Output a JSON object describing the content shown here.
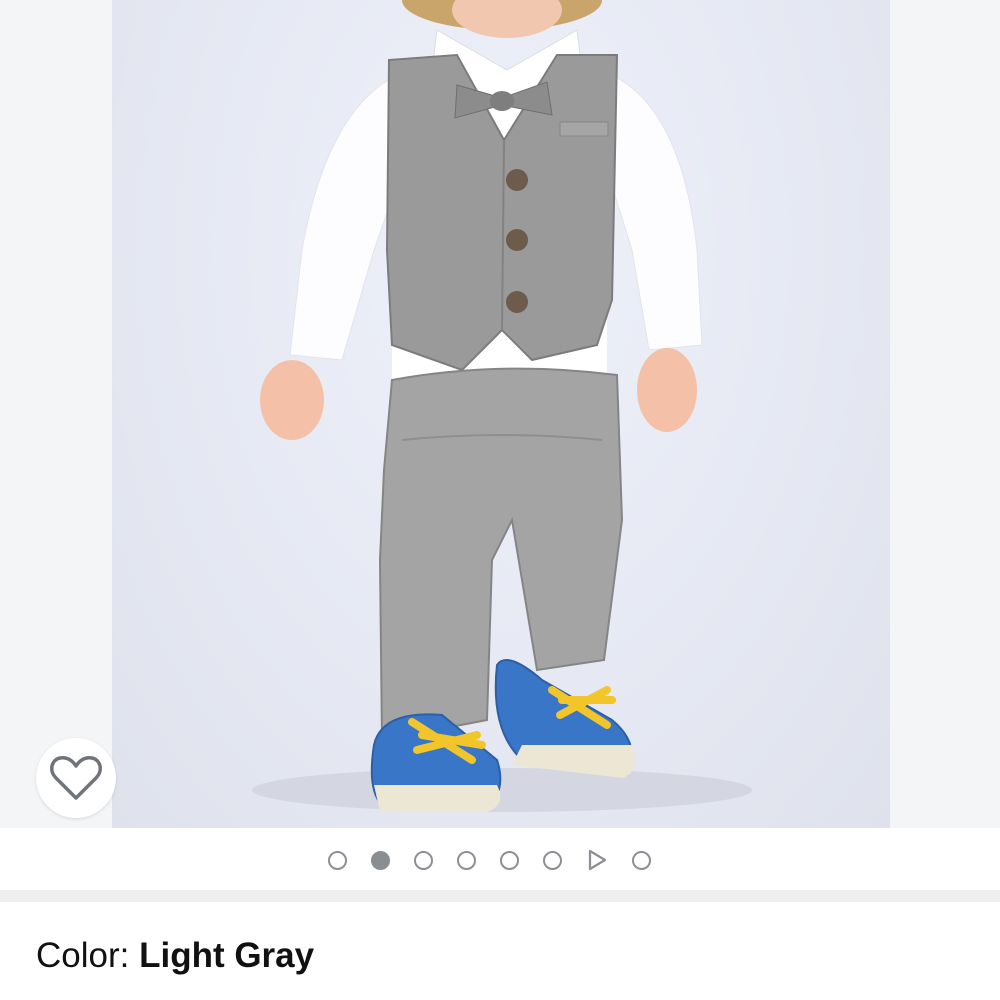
{
  "product_image": {
    "alt": "Toddler boy in light gray herringbone vest, white shirt with bow tie, gray pants and blue sneakers",
    "total_images": 8,
    "active_index": 1,
    "slides": [
      "image",
      "image",
      "image",
      "image",
      "image",
      "image",
      "video",
      "image"
    ]
  },
  "wishlist": {
    "icon": "heart-outline-icon",
    "icon_color": "#707478"
  },
  "pagination": {
    "active_color": "#8a8d91",
    "inactive_border": "#8c8f94"
  },
  "variation": {
    "label": "Color: ",
    "value": "Light Gray"
  }
}
